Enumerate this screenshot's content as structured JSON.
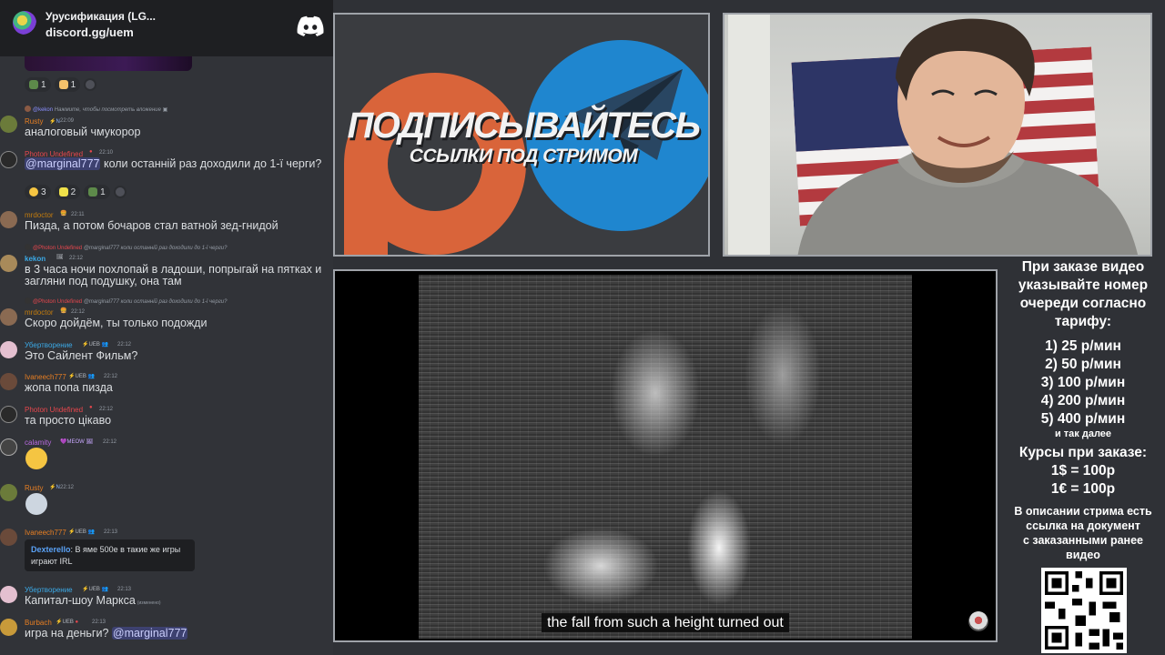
{
  "server": {
    "name": "Урусификация (LG...",
    "invite": "discord.gg/uem",
    "logo_icon": "discord-logo-icon"
  },
  "top_reactions": [
    {
      "icon": "server-emoji",
      "count": "1"
    },
    {
      "icon": "pray-emoji",
      "count": "1"
    }
  ],
  "messages": [
    {
      "reply": {
        "name": "@kekon",
        "text": "Нажмите, чтобы посмотреть вложение"
      },
      "author": "Rusty",
      "author_color": "#e67e22",
      "time": "22:09",
      "text": "аналоговый чмукорор"
    },
    {
      "author": "Photon Undefined",
      "author_color": "#e8474d",
      "time": "22:10",
      "mention": "@marginal777",
      "text": " коли останній раз доходили до 1-ї черги?",
      "reactions": [
        {
          "icon": "grin-emoji",
          "count": "3"
        },
        {
          "icon": "clown-emoji",
          "count": "2"
        },
        {
          "icon": "server-emoji",
          "count": "1"
        }
      ]
    },
    {
      "author": "mrdoctor",
      "author_color": "#c27c0e",
      "time": "22:11",
      "text": "Пизда, а потом бочаров стал ватной зед-гнидой"
    },
    {
      "reply": {
        "name": "@Photon Undefined",
        "text": "@marginal777 коли останній раз доходили до 1-ї черги?"
      },
      "author": "kekon",
      "author_color": "#3ba9e6",
      "time": "22:12",
      "text": "в 3 часа ночи похлопай в ладоши, попрыгай на пятках и загляни под подушку, она там"
    },
    {
      "reply": {
        "name": "@Photon Undefined",
        "text": "@marginal777 коли останній раз доходили до 1-ї черги?"
      },
      "author": "mrdoctor",
      "author_color": "#c27c0e",
      "time": "22:12",
      "text": "Скоро дойдём, ты только подожди"
    },
    {
      "author": "Убертворение",
      "author_color": "#3ba9e6",
      "tag": "UEB",
      "time": "22:12",
      "text": "Это Сайлент Фильм?"
    },
    {
      "author": "Ivaneech777",
      "author_color": "#e67e22",
      "tag": "UEB",
      "time": "22:12",
      "text": "жопа попа пизда"
    },
    {
      "author": "Photon Undefined",
      "author_color": "#e8474d",
      "time": "22:12",
      "text": "та просто цікаво"
    },
    {
      "author": "calamity",
      "author_color": "#b86adf",
      "tag": "MEOW",
      "time": "22:12",
      "emoji": "laughing-crying-emoji"
    },
    {
      "author": "Rusty",
      "author_color": "#e67e22",
      "time": "22:12",
      "emoji": "nerd-emoji"
    },
    {
      "author": "Ivaneech777",
      "author_color": "#e67e22",
      "tag": "UEB",
      "time": "22:13",
      "quote": {
        "name": "Dexterello",
        "text": ": В яме 500е в такие же игры играют IRL"
      }
    },
    {
      "author": "Убертворение",
      "author_color": "#3ba9e6",
      "tag": "UEB",
      "time": "22:13",
      "text": "Капитал-шоу Маркса",
      "edited": "(изменено)"
    },
    {
      "author": "Burbach",
      "author_color": "#e67e22",
      "tag": "UEB",
      "time": "22:13",
      "text": "игра на деньги? ",
      "mention_end": "@marginal777"
    }
  ],
  "promo": {
    "title": "ПОДПИСЫВАЙТЕСЬ",
    "subtitle": "ССЫЛКИ ПОД СТРИМОМ",
    "icons": [
      "patreon-logo-icon",
      "telegram-logo-icon"
    ]
  },
  "video": {
    "subtitle": "the fall from such a height turned out"
  },
  "info": {
    "header": [
      "При заказе видео",
      "указывайте номер",
      "очереди согласно",
      "тарифу:"
    ],
    "tariffs": [
      "1) 25 р/мин",
      "2) 50 р/мин",
      "3) 100 р/мин",
      "4) 200 р/мин",
      "5) 400 р/мин"
    ],
    "tariffs_note": "и так далее",
    "rates_title": "Курсы при заказе:",
    "rates": [
      "1$ = 100р",
      "1€ = 100р"
    ],
    "description": [
      "В описании стрима есть",
      "ссылка на документ",
      "с заказанными ранее",
      "видео"
    ]
  }
}
